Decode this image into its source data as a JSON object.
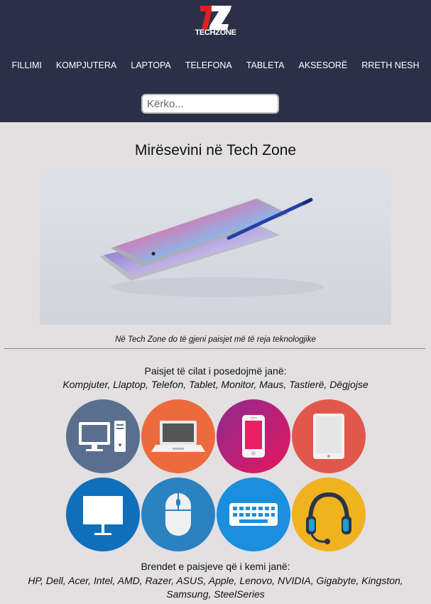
{
  "header": {
    "logo_mark": "TZ",
    "logo_text": "TECHZONE",
    "nav": [
      "FILLIMI",
      "KOMPJUTERA",
      "LAPTOPA",
      "TELEFONA",
      "TABLETA",
      "AKSESORË",
      "RRETH NESH"
    ],
    "search_placeholder": "Kërko..."
  },
  "main": {
    "title": "Mirësevini në Tech Zone",
    "hero_caption": "Në Tech Zone do të gjeni paisjet më të reja teknologjike",
    "devices_title": "Paisjet të cilat i posedojmë janë:",
    "devices_list": "Kompjuter, Llaptop, Telefon, Tablet, Monitor, Maus, Tastierë, Dëgjojse",
    "device_icons": [
      {
        "name": "desktop-computer-icon",
        "color": "#5a6f8d"
      },
      {
        "name": "laptop-icon",
        "color": "#ec6a3c"
      },
      {
        "name": "smartphone-icon",
        "color": "#c5237f"
      },
      {
        "name": "tablet-icon",
        "color": "#e2574c"
      },
      {
        "name": "monitor-icon",
        "color": "#0f6fba"
      },
      {
        "name": "mouse-icon",
        "color": "#2c82c1"
      },
      {
        "name": "keyboard-icon",
        "color": "#1b8ede"
      },
      {
        "name": "headset-icon",
        "color": "#f0b21f"
      }
    ],
    "brands_title": "Brendet e paisjeve që i kemi janë:",
    "brands_list": "HP, Dell, Acer, Intel, AMD, Razer, ASUS, Apple, Lenovo, NVIDIA, Gigabyte, Kingston, Samsung, SteelSeries"
  }
}
